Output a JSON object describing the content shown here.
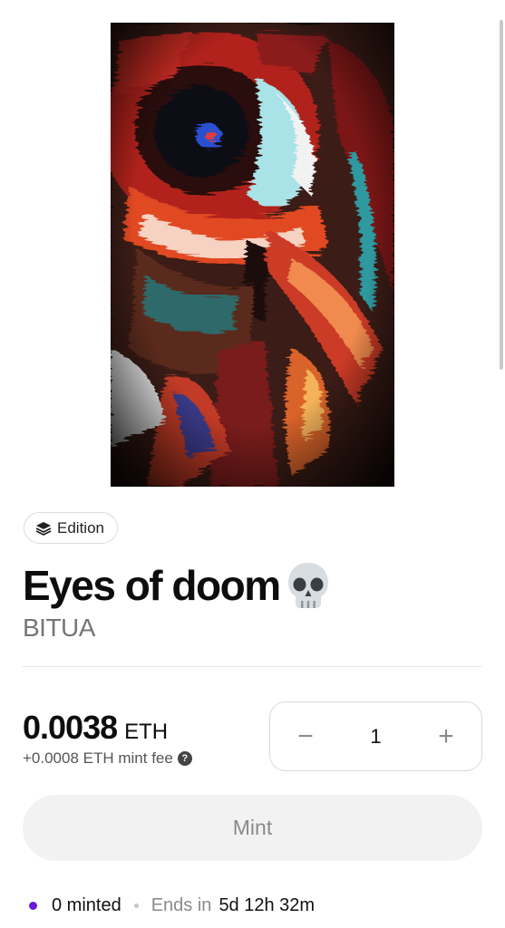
{
  "colors": {
    "accent_dot": "#6a1bd8",
    "mint_bg": "#f2f2f2",
    "muted_text": "#767676"
  },
  "badge": {
    "icon": "layers-icon",
    "label": "Edition"
  },
  "title": {
    "text": "Eyes of doom",
    "emoji": "skull-icon"
  },
  "artist": "BITUA",
  "price": {
    "amount": "0.0038",
    "unit": "ETH",
    "fee": "+0.0008 ETH mint fee",
    "fee_icon": "help-icon"
  },
  "stepper": {
    "minus": "−",
    "quantity": "1",
    "plus": "+"
  },
  "mint_button": "Mint",
  "status": {
    "minted": "0 minted",
    "ends_label": "Ends in",
    "time_left": "5d 12h 32m"
  }
}
